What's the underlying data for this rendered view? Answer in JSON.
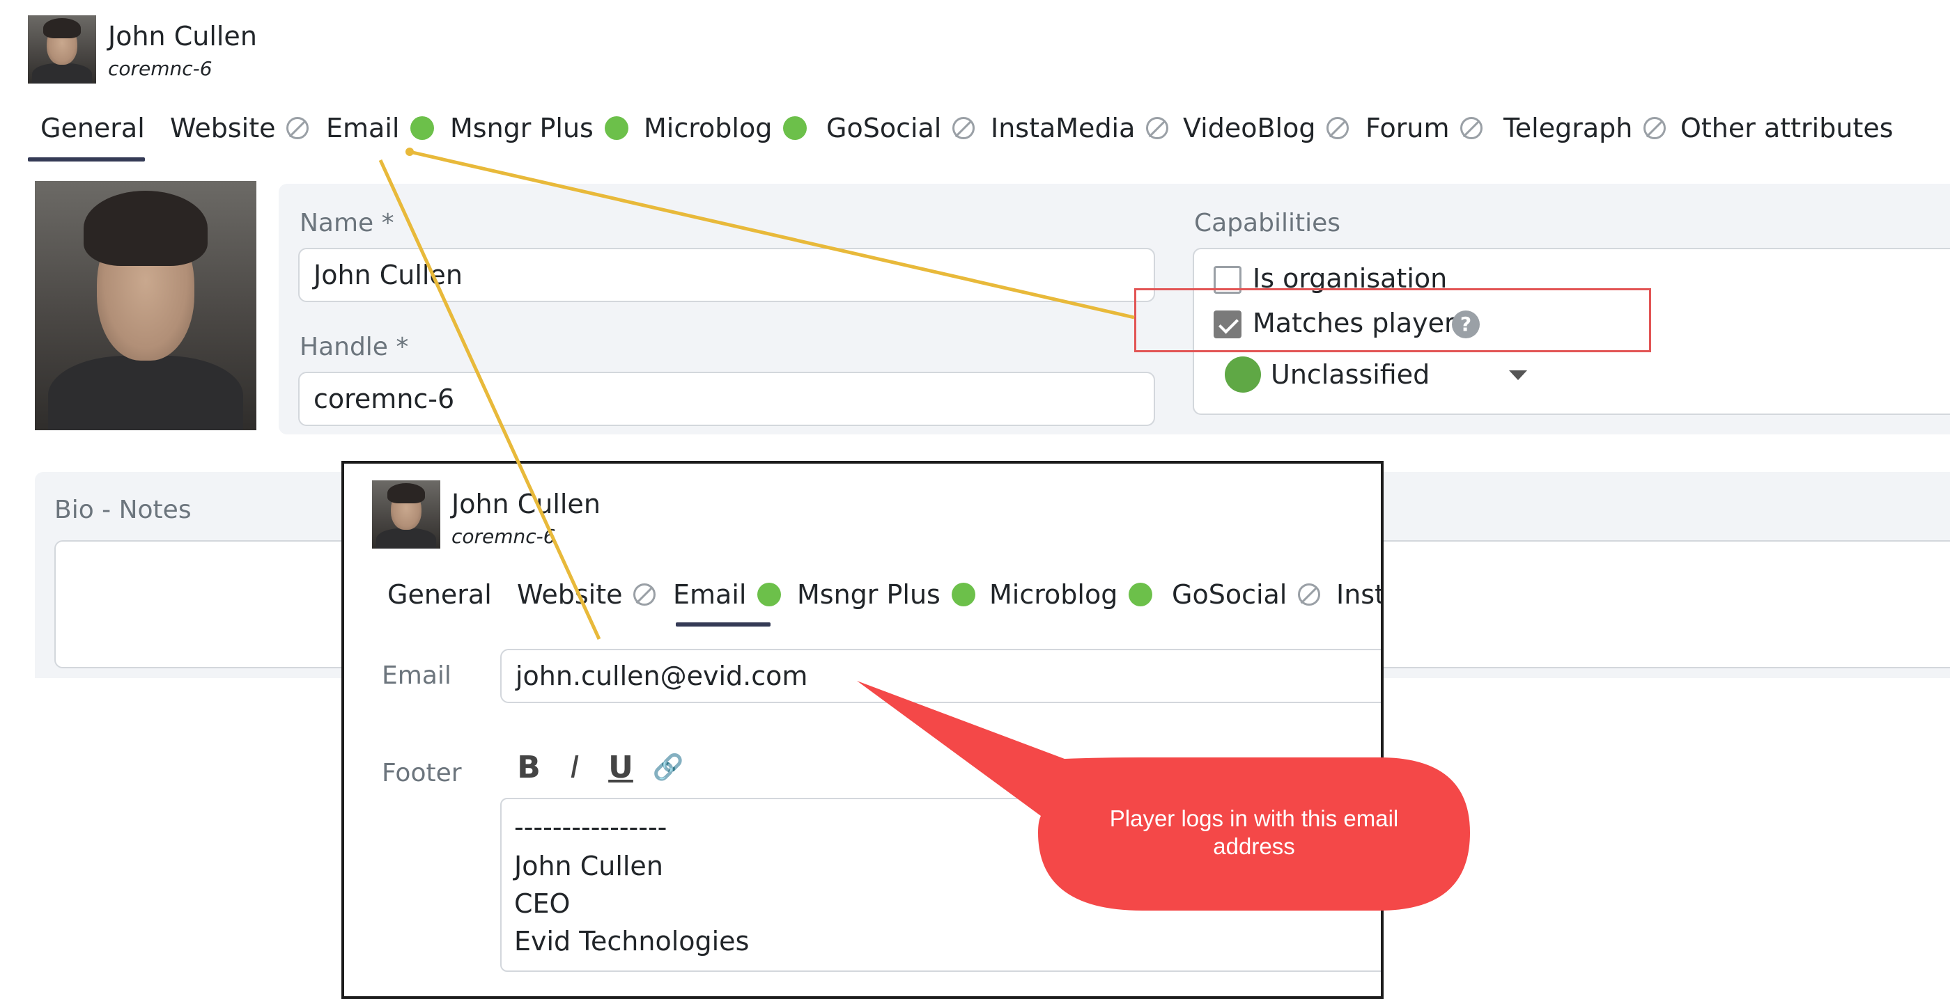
{
  "header": {
    "name": "John Cullen",
    "handle": "coremnc-6"
  },
  "tabs": [
    {
      "label": "General",
      "status": "none",
      "active": true
    },
    {
      "label": "Website",
      "status": "disabled"
    },
    {
      "label": "Email",
      "status": "enabled"
    },
    {
      "label": "Msngr Plus",
      "status": "enabled"
    },
    {
      "label": "Microblog",
      "status": "enabled"
    },
    {
      "label": "GoSocial",
      "status": "disabled"
    },
    {
      "label": "InstaMedia",
      "status": "disabled"
    },
    {
      "label": "VideoBlog",
      "status": "disabled"
    },
    {
      "label": "Forum",
      "status": "disabled"
    },
    {
      "label": "Telegraph",
      "status": "disabled"
    },
    {
      "label": "Other attributes",
      "status": "none"
    }
  ],
  "general": {
    "name_label": "Name *",
    "name_value": "John Cullen",
    "handle_label": "Handle *",
    "handle_value": "coremnc-6",
    "capabilities_label": "Capabilities",
    "is_organisation_label": "Is organisation",
    "is_organisation_checked": false,
    "matches_player_label": "Matches player",
    "matches_player_checked": true,
    "help_glyph": "?",
    "classification_value": "Unclassified",
    "bio_label": "Bio - Notes"
  },
  "inset": {
    "name": "John Cullen",
    "handle": "coremnc-6",
    "tabs": [
      {
        "label": "General",
        "status": "none"
      },
      {
        "label": "Website",
        "status": "disabled"
      },
      {
        "label": "Email",
        "status": "enabled",
        "active": true
      },
      {
        "label": "Msngr Plus",
        "status": "enabled"
      },
      {
        "label": "Microblog",
        "status": "enabled"
      },
      {
        "label": "GoSocial",
        "status": "disabled"
      },
      {
        "label": "Inst",
        "status": "none"
      }
    ],
    "email_label": "Email",
    "email_value": "john.cullen@evid.com",
    "footer_label": "Footer",
    "format_buttons": {
      "bold": "B",
      "italic": "I",
      "underline": "U",
      "link": "🔗"
    },
    "footer_lines": [
      "----------------",
      "John Cullen",
      "CEO",
      "Evid Technologies"
    ]
  },
  "annotation": {
    "callout_text": "Player logs in with this email address"
  },
  "colors": {
    "status_enabled": "#6cc04a",
    "status_disabled": "#9aa0a6",
    "active_tab_underline": "#343a55",
    "callout": "#f44848",
    "arrow": "#e8b93a",
    "highlight_frame": "#e25555",
    "classification_dot": "#5fa845"
  }
}
